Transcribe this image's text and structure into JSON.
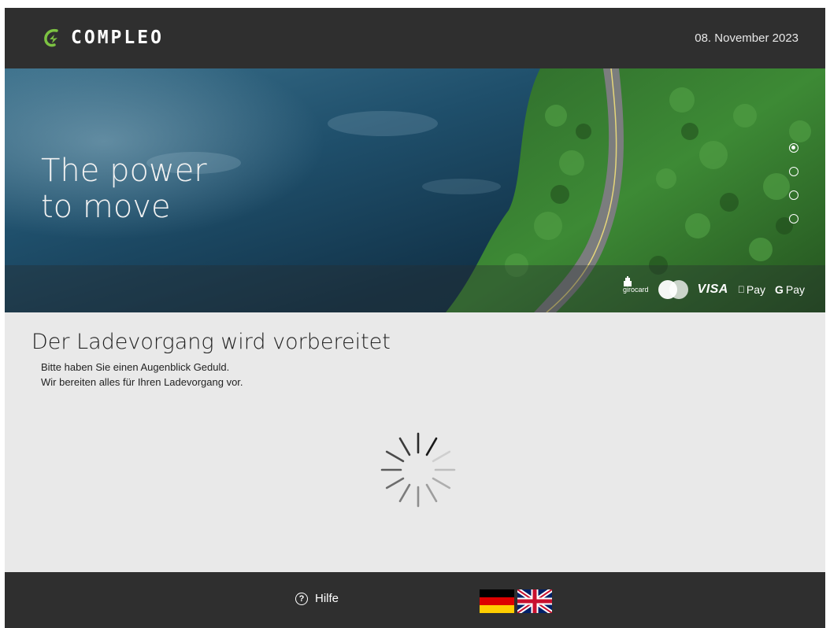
{
  "header": {
    "brand": "COMPLEO",
    "date": "08. November 2023"
  },
  "hero": {
    "tagline_line1": "The power",
    "tagline_line2": "to move",
    "carousel": {
      "total": 4,
      "active": 1
    }
  },
  "payments": {
    "girocard": "girocard",
    "visa": "VISA",
    "apple_pay": "Pay",
    "google_pay_g": "G",
    "google_pay": "Pay",
    "icons": [
      "girocard-icon",
      "mastercard-icon",
      "visa-icon",
      "apple-pay-icon",
      "google-pay-icon"
    ]
  },
  "status": {
    "title": "Der Ladevorgang wird vorbereitet",
    "line1": "Bitte haben Sie einen Augenblick Geduld.",
    "line2": "Wir bereiten alles für Ihren Ladevorgang vor."
  },
  "footer": {
    "help_icon_glyph": "?",
    "help_label": "Hilfe",
    "languages": [
      {
        "code": "de",
        "icon": "german-flag-icon"
      },
      {
        "code": "en",
        "icon": "uk-flag-icon"
      }
    ]
  },
  "colors": {
    "bar_background": "#2f2f2f",
    "content_background": "#e9e9e9",
    "brand_accent": "#7cc242"
  }
}
